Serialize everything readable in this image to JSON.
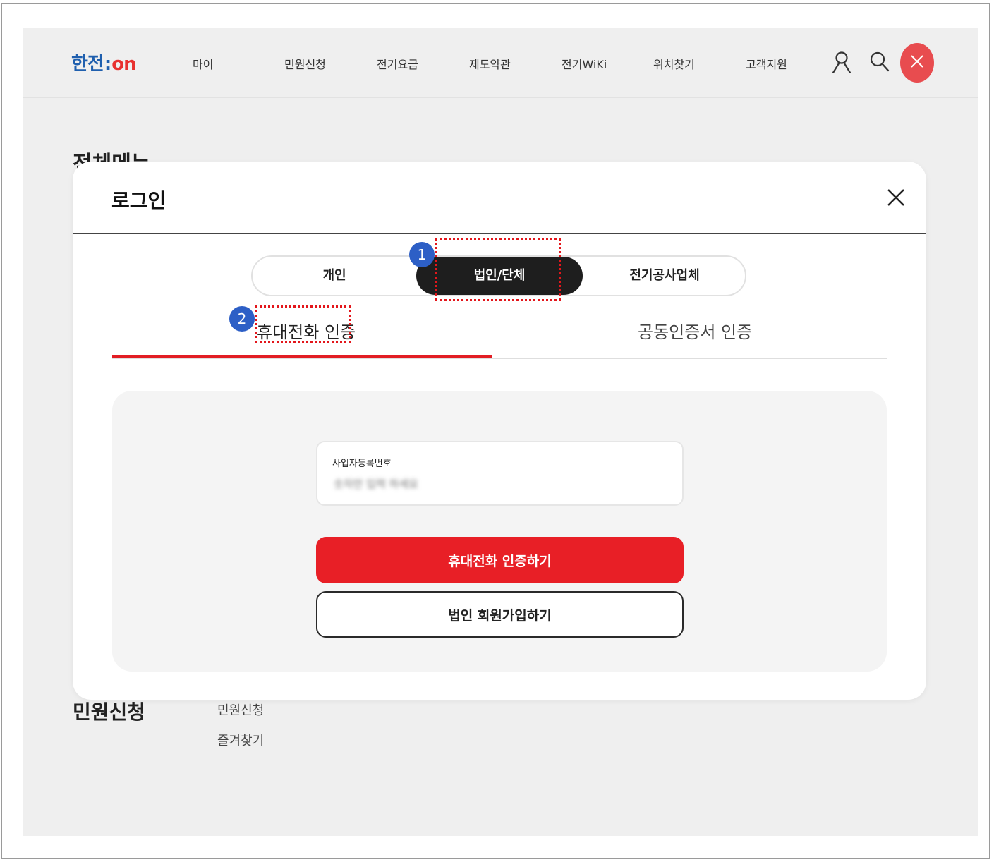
{
  "header": {
    "logo_main": "한전",
    "logo_colon": ":",
    "logo_on": "on",
    "nav": [
      "마이",
      "민원신청",
      "전기요금",
      "제도약관",
      "전기WiKi",
      "위치찾기",
      "고객지원"
    ]
  },
  "background": {
    "menu_title": "전체메뉴",
    "section_title": "민원신청",
    "section_links": [
      "민원신청",
      "즐겨찾기"
    ]
  },
  "modal": {
    "title": "로그인",
    "segment_tabs": [
      "개인",
      "법인/단체",
      "전기공사업체"
    ],
    "active_segment": "법인/단체",
    "sub_tabs": [
      "휴대전화 인증",
      "공동인증서 인증"
    ],
    "active_sub_tab": "휴대전화 인증",
    "field_label": "사업자등록번호",
    "field_placeholder": "숫자만 입력 하세요",
    "primary_button": "휴대전화 인증하기",
    "secondary_button": "법인 회원가입하기"
  },
  "annotations": [
    "1",
    "2"
  ],
  "colors": {
    "brand_blue": "#1f5fae",
    "brand_red": "#e21d23",
    "annotation_blue": "#2d5fc6",
    "annotation_red": "#e3161b"
  },
  "icons": [
    "user-icon",
    "search-icon",
    "close-icon",
    "modal-close-icon"
  ]
}
